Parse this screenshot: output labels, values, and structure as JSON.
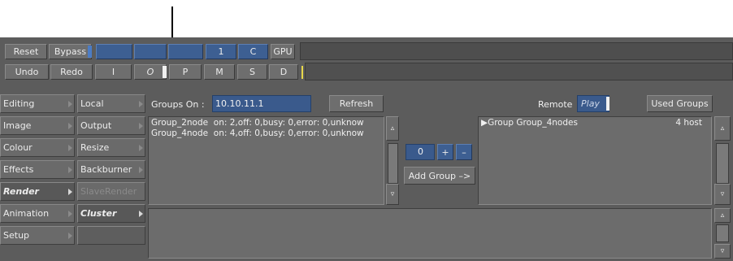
{
  "toolbar": {
    "reset_label": "Reset",
    "bypass_label": "Bypass",
    "channel_1_label": "1",
    "channel_c_label": "C",
    "gpu_label": "GPU",
    "undo_label": "Undo",
    "redo_label": "Redo",
    "i_label": "I",
    "o_label": "O",
    "p_label": "P",
    "m_label": "M",
    "s_label": "S",
    "d_label": "D"
  },
  "menu_col1": {
    "items": [
      {
        "label": "Editing"
      },
      {
        "label": "Image"
      },
      {
        "label": "Colour"
      },
      {
        "label": "Effects"
      },
      {
        "label": "Render"
      },
      {
        "label": "Animation"
      },
      {
        "label": "Setup"
      }
    ],
    "active": "Render"
  },
  "menu_col2": {
    "items": [
      {
        "label": "Local"
      },
      {
        "label": "Output"
      },
      {
        "label": "Resize"
      },
      {
        "label": "Backburner"
      },
      {
        "label": "SlaveRender"
      },
      {
        "label": "Cluster"
      }
    ],
    "active": "Cluster"
  },
  "groups": {
    "groups_on_label": "Groups On :",
    "address_value": "10.10.11.1",
    "refresh_label": "Refresh",
    "rows": [
      {
        "name": "Group_2node",
        "status": "on: 2,off: 0,busy: 0,error: 0,unknow"
      },
      {
        "name": "Group_4node",
        "status": "on: 4,off: 0,busy: 0,error: 0,unknow"
      }
    ]
  },
  "add_group": {
    "count_value": "0",
    "plus_label": "+",
    "minus_label": "–",
    "add_label": "Add Group –>"
  },
  "remote": {
    "remote_label": "Remote",
    "play_label": "Play",
    "used_groups_label": "Used Groups",
    "rows": [
      {
        "name": "Group Group_4nodes",
        "hosts": "4 host"
      }
    ]
  },
  "colors": {
    "panel_bg": "#5c5c5c",
    "accent_blue": "#3d5f92",
    "field_blue": "#3a5a8c",
    "yellow_marker": "#e8d84a"
  }
}
